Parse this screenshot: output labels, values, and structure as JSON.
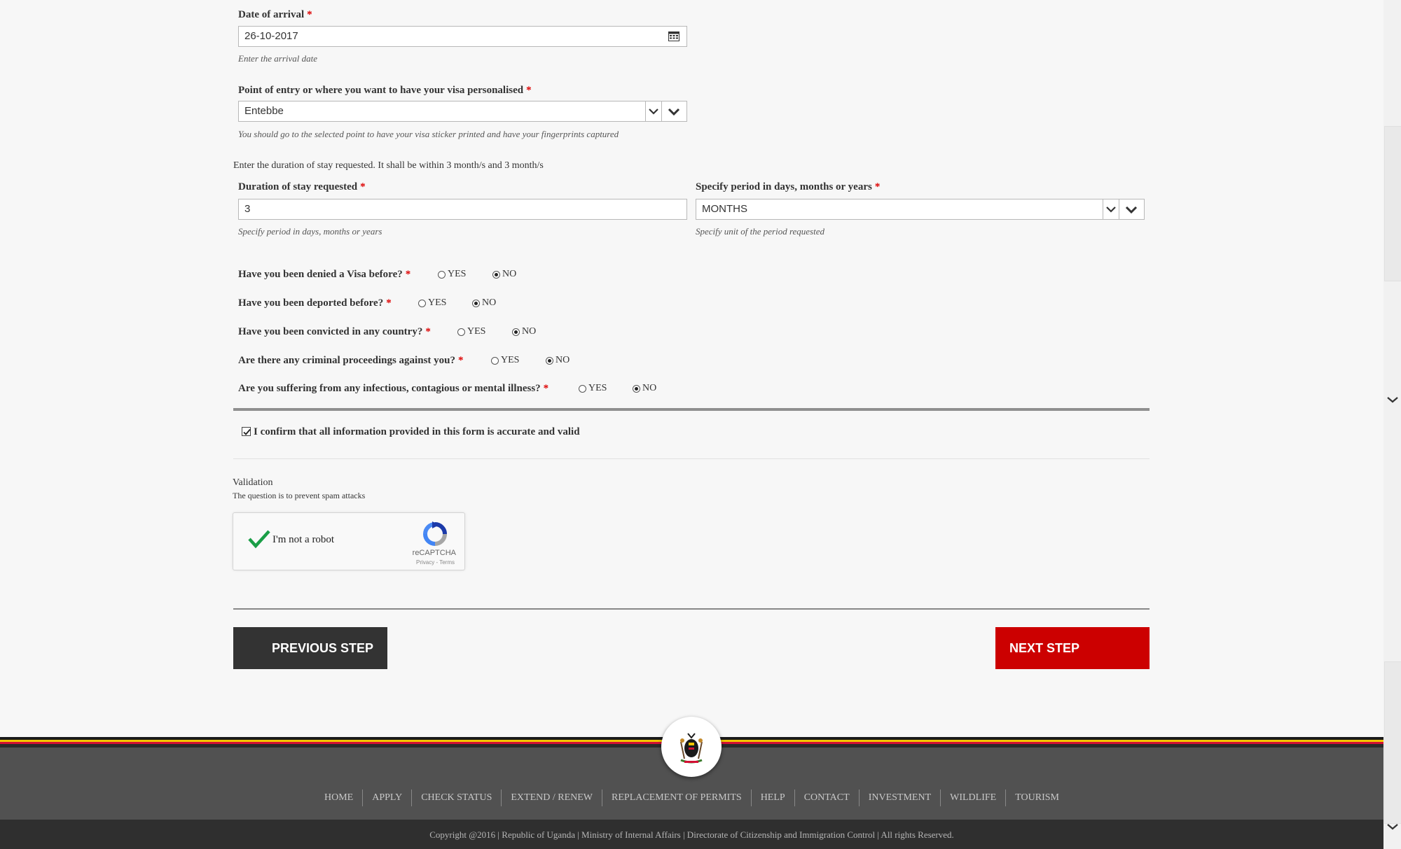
{
  "arrival": {
    "label": "Date of arrival",
    "required": "*",
    "value": "26-10-2017",
    "hint": "Enter the arrival date"
  },
  "entry": {
    "label": "Point of entry or where you want to have your visa personalised",
    "required": "*",
    "value": "Entebbe",
    "hint": "You should go to the selected point to have your visa sticker printed and have your fingerprints captured"
  },
  "duration_note": "Enter the duration of stay requested. It shall be within 3 month/s and 3 month/s",
  "duration": {
    "label": "Duration of stay requested",
    "required": "*",
    "value": "3",
    "hint": "Specify period in days, months or years"
  },
  "period": {
    "label": "Specify period in days, months or years",
    "required": "*",
    "value": "MONTHS",
    "hint": "Specify unit of the period requested"
  },
  "questions": [
    {
      "label": "Have you been denied a Visa before?",
      "required": "*",
      "yes": "YES",
      "no": "NO",
      "selected": "NO"
    },
    {
      "label": "Have you been deported before?",
      "required": "*",
      "yes": "YES",
      "no": "NO",
      "selected": "NO"
    },
    {
      "label": "Have you been convicted in any country?",
      "required": "*",
      "yes": "YES",
      "no": "NO",
      "selected": "NO"
    },
    {
      "label": "Are there any criminal proceedings against you?",
      "required": "*",
      "yes": "YES",
      "no": "NO",
      "selected": "NO"
    },
    {
      "label": "Are you suffering from any infectious, contagious or mental illness?",
      "required": "*",
      "yes": "YES",
      "no": "NO",
      "selected": "NO"
    }
  ],
  "confirm": {
    "checked": true,
    "label": "I confirm that all information provided in this form is accurate and valid"
  },
  "validation": {
    "title": "Validation",
    "subtitle": "The question is to prevent spam attacks",
    "captcha_text": "I'm not a robot",
    "captcha_brand": "reCAPTCHA",
    "captcha_terms": "Privacy - Terms"
  },
  "buttons": {
    "previous": "PREVIOUS STEP",
    "next": "NEXT STEP"
  },
  "footer": {
    "nav": [
      "HOME",
      "APPLY",
      "CHECK STATUS",
      "EXTEND / RENEW",
      "REPLACEMENT OF PERMITS",
      "HELP",
      "CONTACT",
      "INVESTMENT",
      "WILDLIFE",
      "TOURISM"
    ],
    "copyright": "Copyright @2016 | Republic of Uganda | Ministry of Internal Affairs | Directorate of Citizenship and Immigration Control | All rights Reserved."
  },
  "colors": {
    "next_button": "#cc0000",
    "previous_button": "#333333",
    "required": "#dd0000",
    "footer_stripe_black": "#000000",
    "footer_stripe_yellow": "#f2c500",
    "footer_stripe_red": "#d21034"
  }
}
